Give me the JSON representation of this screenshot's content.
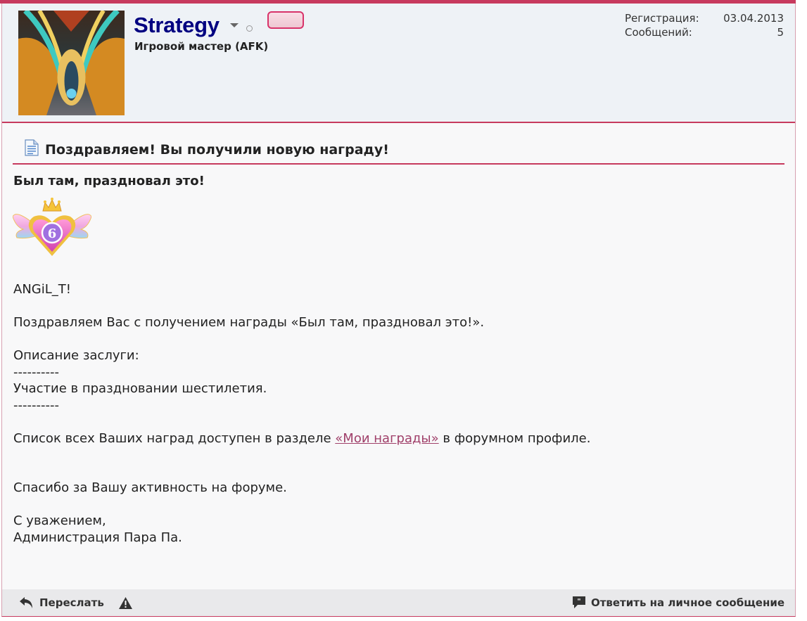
{
  "user": {
    "name": "Strategy",
    "title": "Игровой мастер (AFK)",
    "registration_label": "Регистрация:",
    "registration_value": "03.04.2013",
    "posts_label": "Сообщений:",
    "posts_value": "5"
  },
  "message": {
    "title": "Поздравляем! Вы получили новую награду!",
    "award_name": "Был там, праздновал это!",
    "award_icon": "heart-crown-6-icon",
    "greeting": "ANGiL_T!",
    "line_congrats": "Поздравляем Вас с получением награды «Был там, праздновал это!».",
    "desc_label": "Описание заслуги:",
    "separator": "----------",
    "desc_text": "Участие в праздновании шестилетия.",
    "list_before": "Список всех Ваших наград доступен в разделе ",
    "list_link": "«Мои награды»",
    "list_after": " в форумном профиле.",
    "thanks": "Спасибо за Вашу активность на форуме.",
    "regards": "С уважением,",
    "signature": "Администрация Пара Па."
  },
  "footer": {
    "forward_label": "Переслать",
    "reply_label": "Ответить на личное сообщение"
  },
  "colors": {
    "accent": "#c73a5e",
    "username": "#000080",
    "link": "#a0406a"
  }
}
